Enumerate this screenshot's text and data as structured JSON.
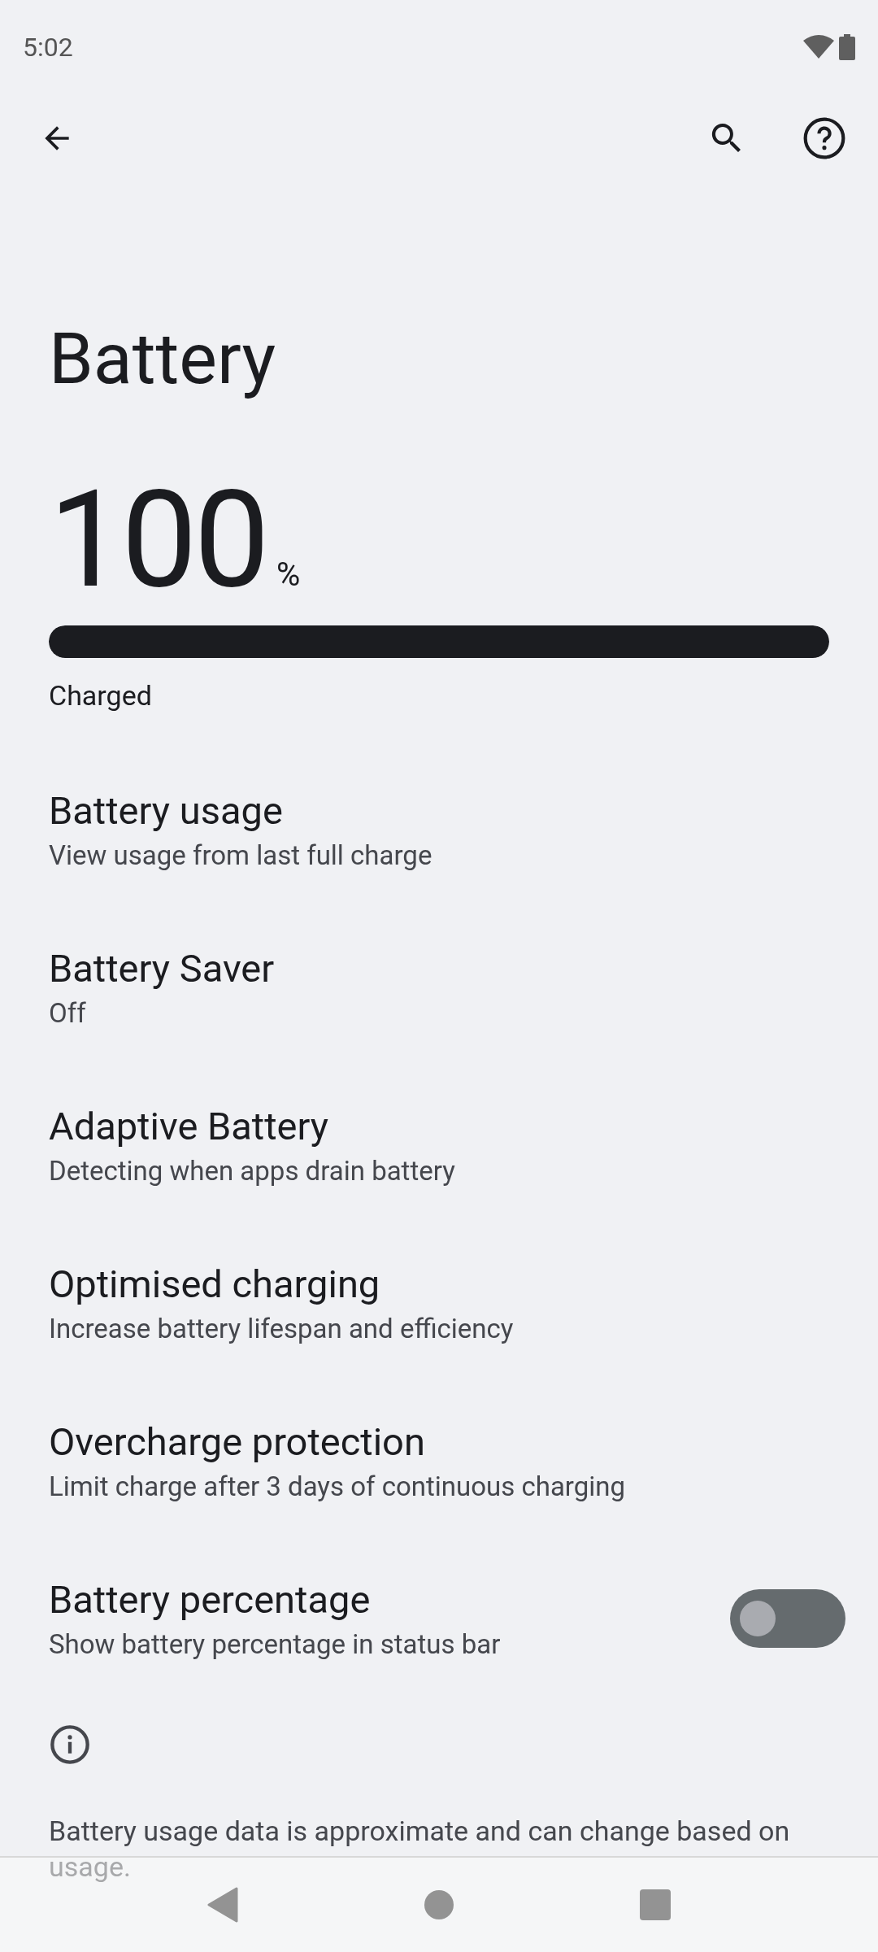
{
  "status_bar": {
    "time": "5:02"
  },
  "title": "Battery",
  "battery": {
    "percent": "100",
    "unit": "%",
    "level": 1,
    "status": "Charged"
  },
  "items": [
    {
      "kind": "text",
      "title": "Battery usage",
      "subtitle": "View usage from last full charge"
    },
    {
      "kind": "text",
      "title": "Battery Saver",
      "subtitle": "Off"
    },
    {
      "kind": "text",
      "title": "Adaptive Battery",
      "subtitle": "Detecting when apps drain battery"
    },
    {
      "kind": "text",
      "title": "Optimised charging",
      "subtitle": "Increase battery lifespan and efficiency"
    },
    {
      "kind": "text",
      "title": "Overcharge protection",
      "subtitle": "Limit charge after 3 days of continuous charging"
    },
    {
      "kind": "toggle",
      "title": "Battery percentage",
      "subtitle": "Show battery percentage in status bar",
      "on": false
    }
  ],
  "footer": "Battery usage data is approximate and can change based on usage."
}
